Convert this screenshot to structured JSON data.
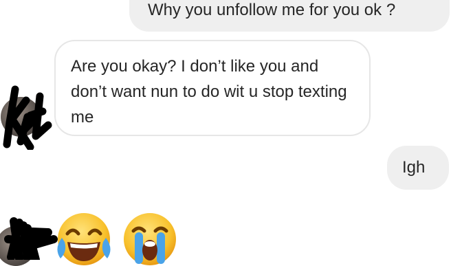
{
  "messages": [
    {
      "side": "sent",
      "text": "Why you unfollow me for you ok  ?"
    },
    {
      "side": "received",
      "text": "Are you okay? I don’t like you and don’t want nun to do wit u stop texting me"
    },
    {
      "side": "sent",
      "text": "Igh"
    },
    {
      "side": "received",
      "emojis": [
        "face-with-tears-of-joy",
        "loudly-crying-face"
      ]
    }
  ],
  "colors": {
    "sent_bubble": "#efefef",
    "received_border": "#e6e6e6",
    "text": "#262626",
    "emoji_yellow": "#f8c12c",
    "tear_blue": "#4aa3e8"
  }
}
